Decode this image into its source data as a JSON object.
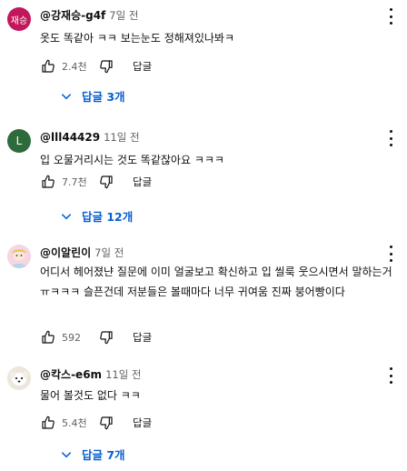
{
  "comments": [
    {
      "author": "@강재승-g4f",
      "time": "7일 전",
      "avatar_text": "재승",
      "avatar_color": "#c2185b",
      "text": "옷도 똑같아 ㅋㅋ 보는눈도 정해져있나봐ㅋ",
      "likes": "2.4천",
      "reply_label": "답글",
      "replies_label": "답글 3개"
    },
    {
      "author": "@lll44429",
      "time": "11일 전",
      "avatar_text": "L",
      "avatar_color": "#2e6b3a",
      "text": "입 오물거리시는 것도 똑같잖아요 ㅋㅋㅋ",
      "likes": "7.7천",
      "reply_label": "답글",
      "replies_label": "답글 12개"
    },
    {
      "author": "@이알린이",
      "time": "7일 전",
      "avatar_text": "",
      "avatar_color": "#f5c8d8",
      "text": "어디서 헤어졌냔 질문에 이미 얼굴보고 확신하고 입 씰룩 웃으시면서 말하는거 ㅠㅋㅋㅋ 슬픈건데 저분들은 볼때마다 너무 귀여움 진짜 붕어빵이다",
      "likes": "592",
      "reply_label": "답글"
    },
    {
      "author": "@칵스-e6m",
      "time": "11일 전",
      "avatar_text": "",
      "avatar_color": "#e9e2d8",
      "text": "물어 볼것도 없다  ㅋㅋ",
      "likes": "5.4천",
      "reply_label": "답글",
      "replies_label": "답글 7개"
    }
  ],
  "icons": {
    "like": "thumb-up-icon",
    "dislike": "thumb-down-icon",
    "more": "more-vert-icon",
    "expand": "chevron-down-icon"
  },
  "colors": {
    "link_blue": "#065fd4",
    "meta_gray": "#606060",
    "text": "#0f0f0f"
  }
}
